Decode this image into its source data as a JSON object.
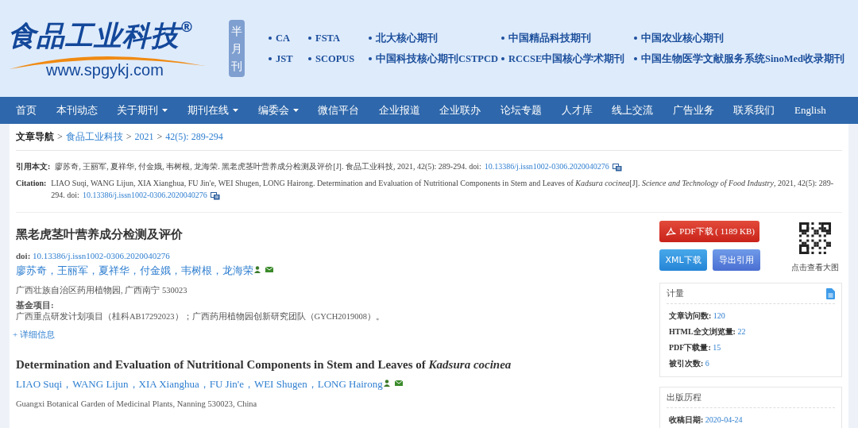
{
  "header": {
    "logo_text": "食品工业科技",
    "registered": "®",
    "url": "www.spgykj.com",
    "frequency": "半月刊",
    "indexes": [
      [
        "CA",
        "FSTA",
        "北大核心期刊",
        "中国精品科技期刊",
        "中国农业核心期刊"
      ],
      [
        "JST",
        "SCOPUS",
        "中国科技核心期刊CSTPCD",
        "RCCSE中国核心学术期刊",
        "中国生物医学文献服务系统SinoMed收录期刊"
      ]
    ]
  },
  "nav": [
    {
      "label": "首页",
      "dropdown": false
    },
    {
      "label": "本刊动态",
      "dropdown": false
    },
    {
      "label": "关于期刊",
      "dropdown": true
    },
    {
      "label": "期刊在线",
      "dropdown": true
    },
    {
      "label": "编委会",
      "dropdown": true
    },
    {
      "label": "微信平台",
      "dropdown": false
    },
    {
      "label": "企业报道",
      "dropdown": false
    },
    {
      "label": "企业联办",
      "dropdown": false
    },
    {
      "label": "论坛专题",
      "dropdown": false
    },
    {
      "label": "人才库",
      "dropdown": false
    },
    {
      "label": "线上交流",
      "dropdown": false
    },
    {
      "label": "广告业务",
      "dropdown": false
    },
    {
      "label": "联系我们",
      "dropdown": false
    },
    {
      "label": "English",
      "dropdown": false
    }
  ],
  "breadcrumb": {
    "label": "文章导航",
    "separator": ">",
    "links": [
      "食品工业科技",
      "2021",
      "42(5): 289-294"
    ]
  },
  "citations": [
    {
      "label": "引用本文:",
      "text": "廖苏奇, 王丽军, 夏祥华, 付金娥, 韦树根, 龙海荣. 黑老虎茎叶营养成分检测及评价[J]. 食品工业科技, 2021, 42(5): 289-294. doi:",
      "doi": "10.13386/j.issn1002-0306.2020040276"
    },
    {
      "label": "Citation:",
      "text": "LIAO Suqi, WANG Lijun, XIA Xianghua, FU Jin'e, WEI Shugen, LONG Hairong. Determination and Evaluation of Nutritional Components in Stem and Leaves of *Kadsura cocinea*[J]. *Science and Technology of Food Industry*, 2021, 42(5): 289-294. doi:",
      "doi": "10.13386/j.issn1002-0306.2020040276"
    }
  ],
  "article": {
    "title": "黑老虎茎叶营养成分检测及评价",
    "doi_label": "doi:",
    "doi": "10.13386/j.issn1002-0306.2020040276",
    "separator": "，",
    "authors": [
      "廖苏奇",
      "王丽军",
      "夏祥华",
      "付金娥",
      "韦树根",
      "龙海荣"
    ],
    "affiliation": "广西壮族自治区药用植物园, 广西南宁 530023",
    "fund_label": "基金项目:",
    "fund": "广西重点研发计划项目（桂科AB17292023）；广西药用植物园创新研究团队（GYCH2019008）。",
    "details_toggle": "+ 详细信息",
    "title_en": "Determination and Evaluation of Nutritional Components in Stem and Leaves of *Kadsura cocinea*",
    "separator_en": "，",
    "authors_en": [
      "LIAO Suqi",
      "WANG Lijun",
      "XIA Xianghua",
      "FU Jin'e",
      "WEI Shugen",
      "LONG Hairong"
    ],
    "affiliation_en": "Guangxi Botanical Garden of Medicinal Plants, Nanning 530023, China"
  },
  "sidebar": {
    "pdf_button": "PDF下载 ( 1189 KB)",
    "buttons": [
      "XML下载",
      "导出引用"
    ],
    "qr_caption": "点击查看大图",
    "metrics": {
      "title": "计量",
      "rows": [
        {
          "label": "文章访问数:",
          "value": "120"
        },
        {
          "label": "HTML全文浏览量:",
          "value": "22"
        },
        {
          "label": "PDF下载量:",
          "value": "15"
        },
        {
          "label": "被引次数:",
          "value": "6"
        }
      ]
    },
    "history": {
      "title": "出版历程",
      "rows": [
        {
          "label": "收稿日期:",
          "value": "2020-04-24"
        }
      ]
    }
  }
}
